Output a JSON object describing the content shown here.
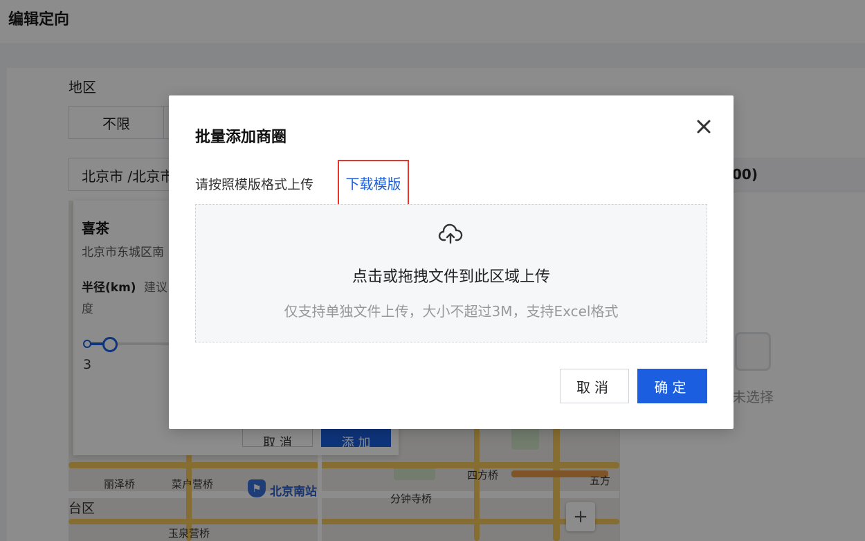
{
  "page": {
    "title": "编辑定向"
  },
  "region": {
    "label": "地区",
    "unlimited": "不限",
    "select_value": "北京市 /北京市"
  },
  "right_panel": {
    "count": "00)",
    "empty_text": "未选择"
  },
  "info_card": {
    "name": "喜茶",
    "address": "北京市东城区南",
    "radius_label": "半径(km)",
    "radius_hint": "建议",
    "radius_hint2": "度",
    "radius_value": "3",
    "cancel": "取 消",
    "add": "添 加"
  },
  "map": {
    "labels": {
      "lize": "丽泽桥",
      "caihu": "菜户营桥",
      "station": "北京南站",
      "sifang": "四方桥",
      "wufang": "五方",
      "fenzhong": "分钟寺桥",
      "yuquan": "玉泉营桥",
      "district": "台区"
    },
    "zoom_in": "+"
  },
  "modal": {
    "title": "批量添加商圈",
    "instruction": "请按照模版格式上传",
    "download": "下载模版",
    "upload_main": "点击或拖拽文件到此区域上传",
    "upload_sub": "仅支持单独文件上传，大小不超过3M，支持Excel格式",
    "cancel": "取消",
    "confirm": "确定"
  }
}
